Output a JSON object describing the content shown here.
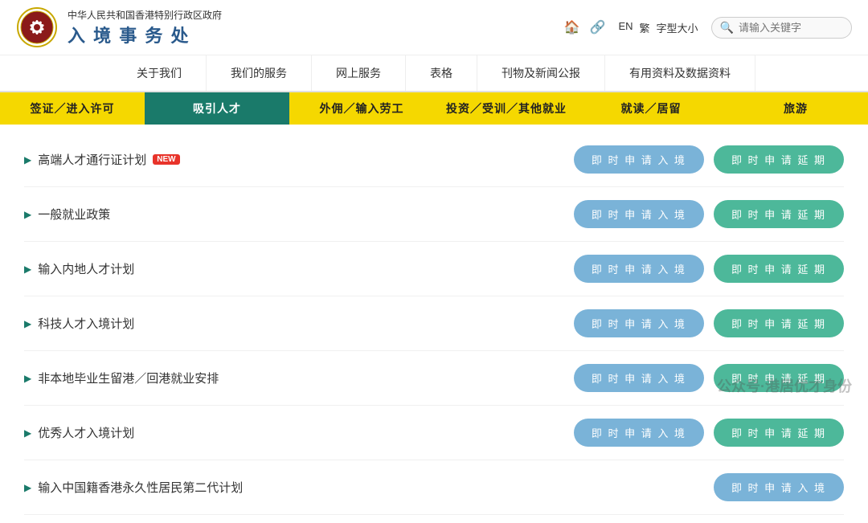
{
  "header": {
    "gov_name": "中华人民共和国香港特别行政区政府",
    "dept_name": "入 境 事 务 处",
    "lang_en": "EN",
    "lang_tc": "繁",
    "font_size": "字型大小",
    "search_placeholder": "请输入关键字"
  },
  "main_nav": {
    "items": [
      {
        "label": "关于我们"
      },
      {
        "label": "我们的服务"
      },
      {
        "label": "网上服务"
      },
      {
        "label": "表格"
      },
      {
        "label": "刊物及新闻公报"
      },
      {
        "label": "有用资料及数据资料"
      }
    ]
  },
  "sub_nav": {
    "items": [
      {
        "label": "签证／进入许可",
        "style": "yellow"
      },
      {
        "label": "吸引人才",
        "style": "teal"
      },
      {
        "label": "外佣／输入劳工",
        "style": "yellow2"
      },
      {
        "label": "投资／受训／其他就业",
        "style": "yellow3"
      },
      {
        "label": "就读／居留",
        "style": "yellow4"
      },
      {
        "label": "旅游",
        "style": "yellow5"
      }
    ]
  },
  "content": {
    "rows": [
      {
        "title": "高端人才通行证计划",
        "is_new": true,
        "btn_apply": "即 时 申 请 入 境",
        "btn_extend": "即 时 申 请 延 期"
      },
      {
        "title": "一般就业政策",
        "is_new": false,
        "btn_apply": "即 时 申 请 入 境",
        "btn_extend": "即 时 申 请 延 期"
      },
      {
        "title": "输入内地人才计划",
        "is_new": false,
        "btn_apply": "即 时 申 请 入 境",
        "btn_extend": "即 时 申 请 延 期"
      },
      {
        "title": "科技人才入境计划",
        "is_new": false,
        "btn_apply": "即 时 申 请 入 境",
        "btn_extend": "即 时 申 请 延 期"
      },
      {
        "title": "非本地毕业生留港／回港就业安排",
        "is_new": false,
        "btn_apply": "即 时 申 请 入 境",
        "btn_extend": "即 时 申 请 延 期"
      },
      {
        "title": "优秀人才入境计划",
        "is_new": false,
        "btn_apply": "即 时 申 请 入 境",
        "btn_extend": "即 时 申 请 延 期"
      },
      {
        "title": "输入中国籍香港永久性居民第二代计划",
        "is_new": false,
        "btn_apply": "即 时 申 请 入 境",
        "btn_extend": ""
      }
    ]
  },
  "watermark": "公众号·港居优才身份"
}
